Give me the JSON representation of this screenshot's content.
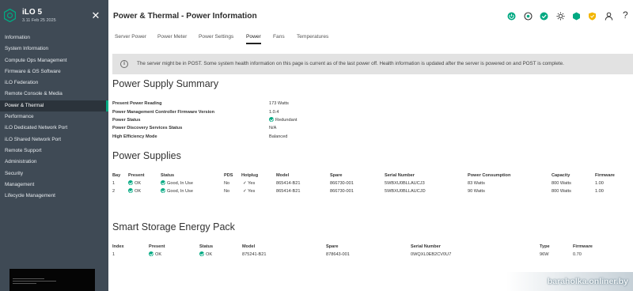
{
  "brand": {
    "name": "iLO 5",
    "version": "3.11 Feb 25 2025"
  },
  "sidebar": {
    "items": [
      {
        "label": "Information"
      },
      {
        "label": "System Information"
      },
      {
        "label": "Compute Ops Management"
      },
      {
        "label": "Firmware & OS Software"
      },
      {
        "label": "iLO Federation"
      },
      {
        "label": "Remote Console & Media"
      },
      {
        "label": "Power & Thermal",
        "active": true
      },
      {
        "label": "Performance"
      },
      {
        "label": "iLO Dedicated Network Port"
      },
      {
        "label": "iLO Shared Network Port"
      },
      {
        "label": "Remote Support"
      },
      {
        "label": "Administration"
      },
      {
        "label": "Security"
      },
      {
        "label": "Management"
      },
      {
        "label": "Lifecycle Management"
      }
    ]
  },
  "header": {
    "title": "Power & Thermal - Power Information",
    "icons": [
      "power-status-icon",
      "health-target-icon",
      "health-ok-icon",
      "uid-light-icon",
      "security-shield-icon",
      "security-badge-icon",
      "user-icon",
      "help-icon"
    ],
    "help_label": "?"
  },
  "tabs": [
    {
      "label": "Server Power"
    },
    {
      "label": "Power Meter"
    },
    {
      "label": "Power Settings"
    },
    {
      "label": "Power",
      "active": true
    },
    {
      "label": "Fans"
    },
    {
      "label": "Temperatures"
    }
  ],
  "banner": {
    "icon": "i",
    "text": "The server might be in POST. Some system health information on this page is current as of the last power off. Health information is updated after the server is powered on and POST is complete."
  },
  "summary": {
    "title": "Power Supply Summary",
    "rows": [
      {
        "label": "Present Power Reading",
        "value": "173 Watts"
      },
      {
        "label": "Power Management Controller Firmware Version",
        "value": "1.0.4"
      },
      {
        "label": "Power Status",
        "value": "Redundant",
        "ok": true
      },
      {
        "label": "Power Discovery Services Status",
        "value": "N/A"
      },
      {
        "label": "High Efficiency Mode",
        "value": "Balanced"
      }
    ]
  },
  "supplies": {
    "title": "Power Supplies",
    "headers": [
      "Bay",
      "Present",
      "Status",
      "PDS",
      "Hotplug",
      "Model",
      "Spare",
      "Serial Number",
      "Power Consumption",
      "Capacity",
      "Firmware"
    ],
    "rows": [
      [
        "1",
        "OK",
        "Good, In Use",
        "No",
        "Yes",
        "865414-B21",
        "866730-001",
        "5WBXU0BLLAUCJ3",
        "83 Watts",
        "800 Watts",
        "1.00"
      ],
      [
        "2",
        "OK",
        "Good, In Use",
        "No",
        "Yes",
        "865414-B21",
        "866730-001",
        "5WBXU0BLLAUCJD",
        "90 Watts",
        "800 Watts",
        "1.00"
      ]
    ],
    "hotplug_mark": "✓"
  },
  "energy_pack": {
    "title": "Smart Storage Energy Pack",
    "headers": [
      "Index",
      "Present",
      "Status",
      "Model",
      "Spare",
      "Serial Number",
      "Type",
      "Firmware"
    ],
    "rows": [
      [
        "1",
        "OK",
        "OK",
        "875241-B21",
        "878643-001",
        "0WQXL0EB2CV0U7",
        "96W",
        "0.70"
      ]
    ]
  },
  "watermark": "baraholka.onliner.by",
  "colors": {
    "sidebar": "#3f4a55",
    "accent": "#01a982",
    "banner": "#e2e2e2"
  }
}
